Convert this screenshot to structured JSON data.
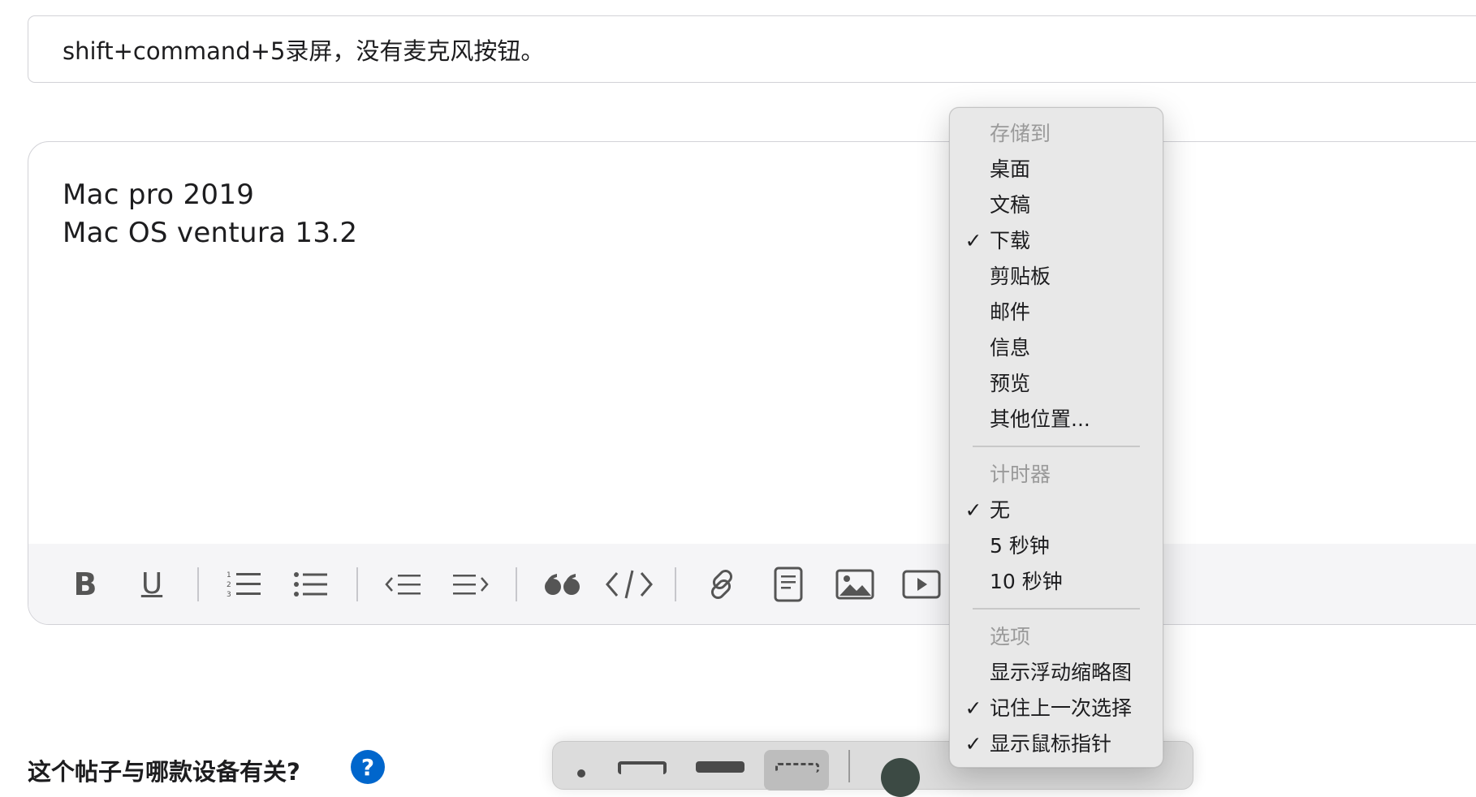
{
  "title_field": {
    "value": "shift+command+5录屏，没有麦克风按钮。"
  },
  "editor": {
    "lines": [
      "Mac pro 2019",
      "Mac OS ventura 13.2"
    ]
  },
  "toolbar": {
    "icons": [
      "bold-icon",
      "underline-icon",
      "numbered-list-icon",
      "bullet-list-icon",
      "outdent-icon",
      "indent-icon",
      "quote-icon",
      "code-icon",
      "link-icon",
      "document-icon",
      "image-icon",
      "video-icon"
    ],
    "bold_glyph": "B",
    "underline_glyph": "U"
  },
  "question": {
    "text": "这个帖子与哪款设备有关?",
    "help": "?"
  },
  "menu": {
    "save_header": "存储到",
    "save_items": [
      {
        "label": "桌面",
        "checked": false
      },
      {
        "label": "文稿",
        "checked": false
      },
      {
        "label": "下载",
        "checked": true
      },
      {
        "label": "剪贴板",
        "checked": false
      },
      {
        "label": "邮件",
        "checked": false
      },
      {
        "label": "信息",
        "checked": false
      },
      {
        "label": "预览",
        "checked": false
      },
      {
        "label": "其他位置...",
        "checked": false
      }
    ],
    "timer_header": "计时器",
    "timer_items": [
      {
        "label": "无",
        "checked": true
      },
      {
        "label": "5 秒钟",
        "checked": false
      },
      {
        "label": "10 秒钟",
        "checked": false
      }
    ],
    "options_header": "选项",
    "options_items": [
      {
        "label": "显示浮动缩略图",
        "checked": false
      },
      {
        "label": "记住上一次选择",
        "checked": true
      },
      {
        "label": "显示鼠标指针",
        "checked": true
      }
    ],
    "check_glyph": "✓"
  },
  "colors": {
    "link_blue": "#0066cc",
    "menu_bg": "#e8e8e8",
    "toolbar_bg": "#f5f5f7"
  }
}
